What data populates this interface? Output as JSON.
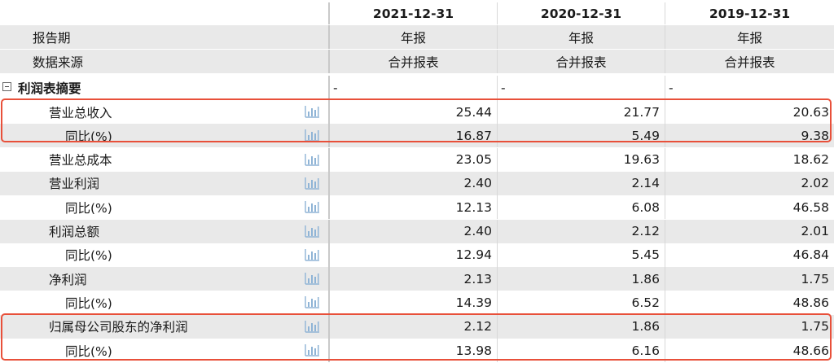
{
  "header": {
    "columns": [
      "2021-12-31",
      "2020-12-31",
      "2019-12-31"
    ]
  },
  "meta_rows": [
    {
      "label": "报告期",
      "values": [
        "年报",
        "年报",
        "年报"
      ]
    },
    {
      "label": "数据来源",
      "values": [
        "合并报表",
        "合并报表",
        "合并报表"
      ]
    }
  ],
  "section": {
    "label": "利润表摘要",
    "values": [
      "-",
      "-",
      "-"
    ]
  },
  "rows": [
    {
      "label": "营业总收入",
      "indent": 1,
      "values": [
        "25.44",
        "21.77",
        "20.63"
      ]
    },
    {
      "label": "同比(%)",
      "indent": 2,
      "values": [
        "16.87",
        "5.49",
        "9.38"
      ]
    },
    {
      "label": "营业总成本",
      "indent": 1,
      "values": [
        "23.05",
        "19.63",
        "18.62"
      ]
    },
    {
      "label": "营业利润",
      "indent": 1,
      "values": [
        "2.40",
        "2.14",
        "2.02"
      ]
    },
    {
      "label": "同比(%)",
      "indent": 2,
      "values": [
        "12.13",
        "6.08",
        "46.58"
      ]
    },
    {
      "label": "利润总额",
      "indent": 1,
      "values": [
        "2.40",
        "2.12",
        "2.01"
      ]
    },
    {
      "label": "同比(%)",
      "indent": 2,
      "values": [
        "12.94",
        "5.45",
        "46.84"
      ]
    },
    {
      "label": "净利润",
      "indent": 1,
      "values": [
        "2.13",
        "1.86",
        "1.75"
      ]
    },
    {
      "label": "同比(%)",
      "indent": 2,
      "values": [
        "14.39",
        "6.52",
        "48.86"
      ]
    },
    {
      "label": "归属母公司股东的净利润",
      "indent": 1,
      "values": [
        "2.12",
        "1.86",
        "1.75"
      ]
    },
    {
      "label": "同比(%)",
      "indent": 2,
      "values": [
        "13.98",
        "6.16",
        "48.66"
      ]
    }
  ],
  "icons": {
    "chart": "bar-chart-icon",
    "collapse": "collapse-minus-icon"
  },
  "colors": {
    "highlight": "#e8503a",
    "icon": "#8fb4d6",
    "row_gray": "#e9e9e9"
  }
}
